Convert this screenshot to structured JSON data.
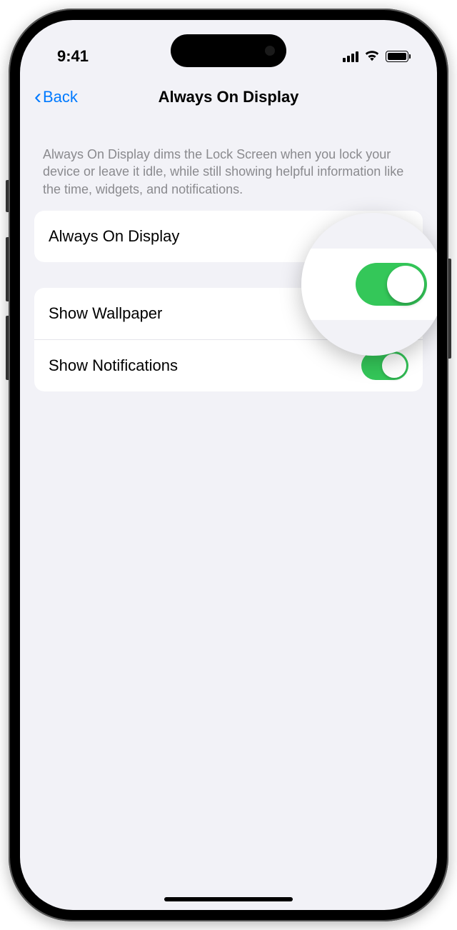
{
  "status": {
    "time": "9:41"
  },
  "nav": {
    "back_label": "Back",
    "title": "Always On Display"
  },
  "description": "Always On Display dims the Lock Screen when you lock your device or leave it idle, while still showing helpful information like the time, widgets, and notifications.",
  "settings": {
    "always_on": {
      "label": "Always On Display",
      "enabled": true
    },
    "show_wallpaper": {
      "label": "Show Wallpaper",
      "enabled": true
    },
    "show_notifications": {
      "label": "Show Notifications",
      "enabled": true
    }
  }
}
